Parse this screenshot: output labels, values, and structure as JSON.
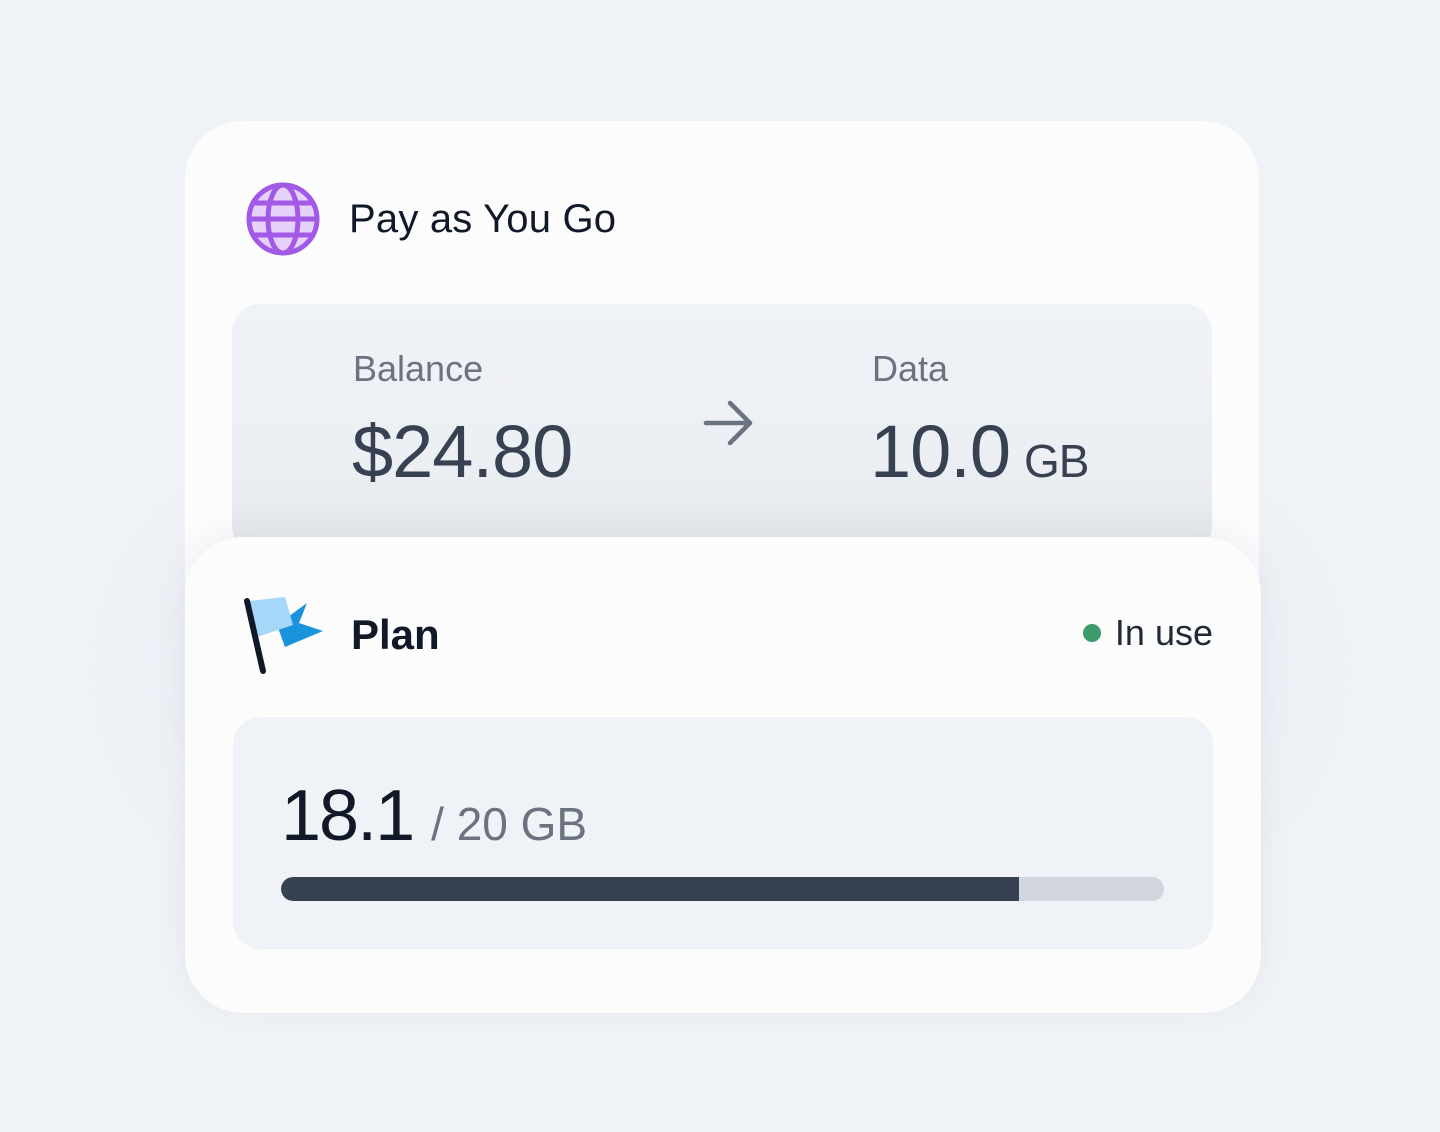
{
  "payg": {
    "title": "Pay as You Go",
    "balance_label": "Balance",
    "balance_value": "$24.80",
    "data_label": "Data",
    "data_value": "10.0",
    "data_unit": "GB",
    "icon": "globe-icon",
    "accent_color": "#a259e6"
  },
  "plan": {
    "title": "Plan",
    "icon": "flag-icon",
    "status": "In use",
    "status_color": "#3d9a6b",
    "used": "18.1",
    "total": "/ 20 GB",
    "progress_fraction": 0.836
  }
}
